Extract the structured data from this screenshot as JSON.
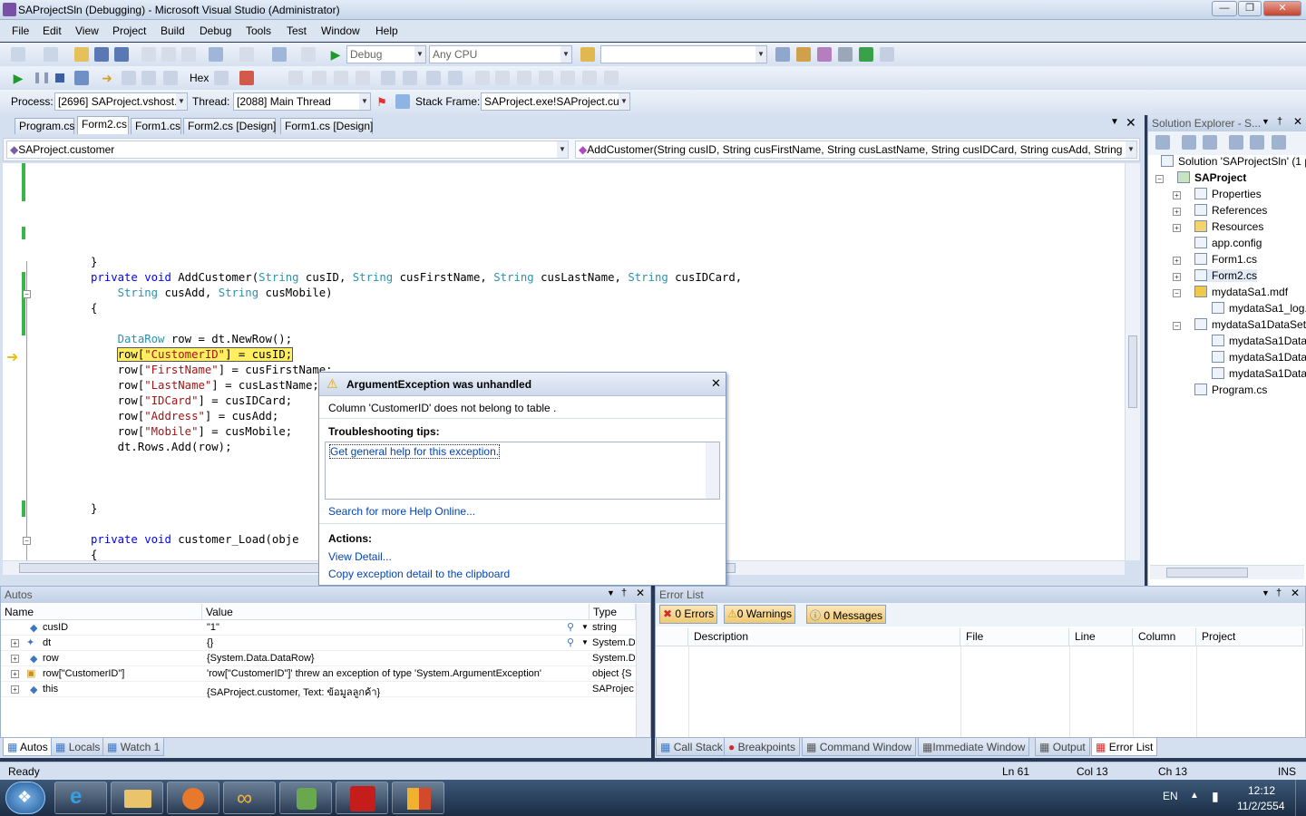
{
  "window": {
    "title": "SAProjectSln (Debugging) - Microsoft Visual Studio (Administrator)"
  },
  "menu": [
    "File",
    "Edit",
    "View",
    "Project",
    "Build",
    "Debug",
    "Tools",
    "Test",
    "Window",
    "Help"
  ],
  "toolbar1": {
    "config": "Debug",
    "platform": "Any CPU",
    "find": ""
  },
  "toolbar2": {
    "hex_label": "Hex"
  },
  "debugbar": {
    "process_label": "Process:",
    "process_value": "[2696] SAProject.vshost.e",
    "thread_label": "Thread:",
    "thread_value": "[2088] Main Thread",
    "stack_label": "Stack Frame:",
    "stack_value": "SAProject.exe!SAProject.cus"
  },
  "tabs": [
    "Program.cs",
    "Form2.cs",
    "Form1.cs",
    "Form2.cs [Design]",
    "Form1.cs [Design]"
  ],
  "nav": {
    "type": "SAProject.customer",
    "member": "AddCustomer(String cusID, String cusFirstName, String cusLastName, String cusIDCard, String cusAdd, String c"
  },
  "code": {
    "brace_close1": "}",
    "sig_kw1": "private",
    "sig_kw2": "void",
    "sig_name": " AddCustomer(",
    "sig_t1": "String",
    "sig_p1": " cusID, ",
    "sig_t2": "String",
    "sig_p2": " cusFirstName, ",
    "sig_t3": "String",
    "sig_p3": " cusLastName, ",
    "sig_t4": "String",
    "sig_p4": " cusIDCard,",
    "sig2_t1": "String",
    "sig2_p1": " cusAdd, ",
    "sig2_t2": "String",
    "sig2_p2": " cusMobile)",
    "brace_open": "{",
    "l1_type": "DataRow",
    "l1_rest": " row = dt.NewRow();",
    "l2_a": "row[",
    "l2_s": "\"CustomerID\"",
    "l2_b": "] = cusID;",
    "l3_a": "row[",
    "l3_s": "\"FirstName\"",
    "l3_b": "] = cusFirstName;",
    "l4_a": "row[",
    "l4_s": "\"LastName\"",
    "l4_b": "] = cusLastName;",
    "l5_a": "row[",
    "l5_s": "\"IDCard\"",
    "l5_b": "] = cusIDCard;",
    "l6_a": "row[",
    "l6_s": "\"Address\"",
    "l6_b": "] = cusAdd;",
    "l7_a": "row[",
    "l7_s": "\"Mobile\"",
    "l7_b": "] = cusMobile;",
    "l8": "dt.Rows.Add(row);",
    "brace_close2": "}",
    "load_kw1": "private",
    "load_kw2": "void",
    "load_name": " customer_Load(obje",
    "brace_open2": "{"
  },
  "exception": {
    "title": "ArgumentException was unhandled",
    "message": "Column 'CustomerID' does not belong to table .",
    "tips_label": "Troubleshooting tips:",
    "tip1": "Get general help for this exception.",
    "search_link": "Search for more Help Online...",
    "actions_label": "Actions:",
    "action1": "View Detail...",
    "action2": "Copy exception detail to the clipboard"
  },
  "solution_explorer": {
    "header": "Solution Explorer - S...",
    "items": [
      {
        "label": "Solution 'SAProjectSln' (1 p"
      },
      {
        "label": "SAProject"
      },
      {
        "label": "Properties"
      },
      {
        "label": "References"
      },
      {
        "label": "Resources"
      },
      {
        "label": "app.config"
      },
      {
        "label": "Form1.cs"
      },
      {
        "label": "Form2.cs"
      },
      {
        "label": "mydataSa1.mdf"
      },
      {
        "label": "mydataSa1_log."
      },
      {
        "label": "mydataSa1DataSet."
      },
      {
        "label": "mydataSa1Data"
      },
      {
        "label": "mydataSa1Data"
      },
      {
        "label": "mydataSa1Data"
      },
      {
        "label": "Program.cs"
      }
    ]
  },
  "autos": {
    "header": "Autos",
    "columns": [
      "Name",
      "Value",
      "Type"
    ],
    "rows": [
      {
        "name": "cusID",
        "value": "\"1\"",
        "type": "string"
      },
      {
        "name": "dt",
        "value": "{}",
        "type": "System.D"
      },
      {
        "name": "row",
        "value": "{System.Data.DataRow}",
        "type": "System.D"
      },
      {
        "name": "row[\"CustomerID\"]",
        "value": "'row[\"CustomerID\"]' threw an exception of type 'System.ArgumentException'",
        "type": "object {S"
      },
      {
        "name": "this",
        "value": "{SAProject.customer, Text: ข้อมูลลูกค้า}",
        "type": "SAProjec"
      }
    ]
  },
  "errorlist": {
    "header": "Error List",
    "errors_btn": "0 Errors",
    "warnings_btn": "0 Warnings",
    "messages_btn": "0 Messages",
    "columns": [
      "Description",
      "File",
      "Line",
      "Column",
      "Project"
    ]
  },
  "bottom_tabs_left": [
    "Autos",
    "Locals",
    "Watch 1"
  ],
  "bottom_tabs_right": [
    "Call Stack",
    "Breakpoints",
    "Command Window",
    "Immediate Window",
    "Output",
    "Error List"
  ],
  "status": {
    "ready": "Ready",
    "ln": "Ln 61",
    "col": "Col 13",
    "ch": "Ch 13",
    "ins": "INS"
  },
  "taskbar": {
    "lang": "EN",
    "time": "12:12",
    "date": "11/2/2554"
  }
}
